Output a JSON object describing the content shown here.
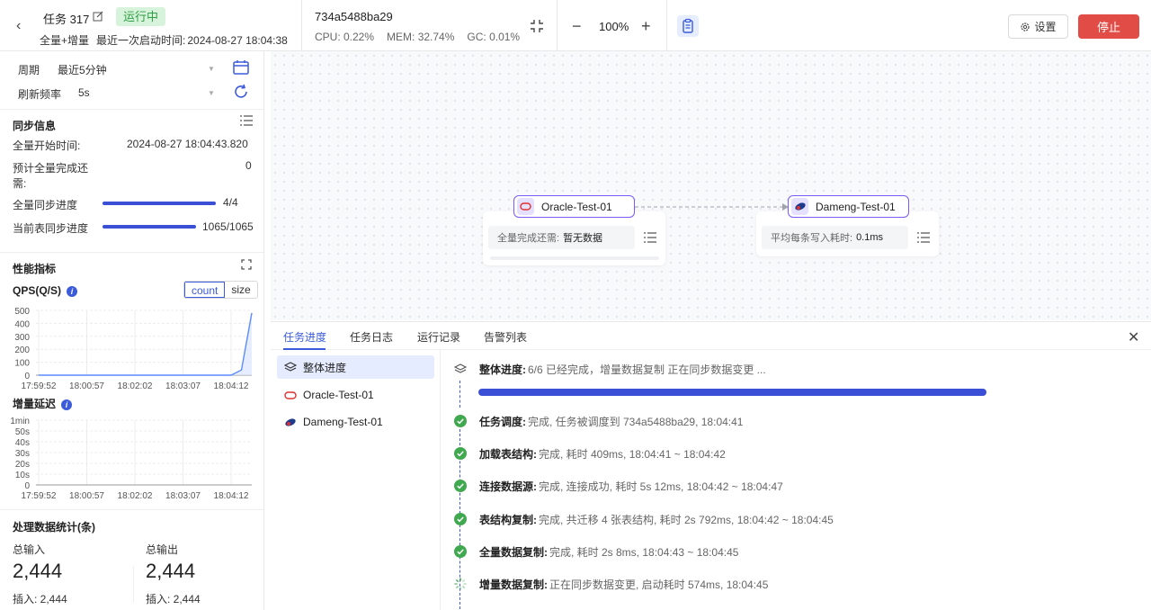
{
  "header": {
    "back_glyph": "‹",
    "task_name": "任务 317",
    "status": "运行中",
    "sync_type": "全量+增量",
    "last_start_label": "最近一次启动时间:",
    "last_start_time": "2024-08-27 18:04:38",
    "agent_id": "734a5488ba29",
    "cpu": "CPU:  0.22%",
    "mem": "MEM:  32.74%",
    "gc": "GC:  0.01%",
    "zoom": "100%",
    "zoom_out": "−",
    "zoom_in": "+",
    "settings_label": "设置",
    "stop_label": "停止",
    "colors": {
      "status_bg": "#d8f3dc",
      "status_fg": "#2f9e44",
      "stop": "#e24c46",
      "accent": "#3b5bdb"
    }
  },
  "filters": {
    "period_label": "周期",
    "period_value": "最近5分钟",
    "refresh_label": "刷新频率",
    "refresh_value": "5s"
  },
  "sync_info": {
    "title": "同步信息",
    "full_start_label": "全量开始时间:",
    "full_start_value": "2024-08-27 18:04:43.820",
    "eta_label_1": "预计全量完成还",
    "eta_label_2": "需:",
    "eta_value": "0",
    "full_progress_label": "全量同步进度",
    "full_progress_text": "4/4",
    "full_progress": 1.0,
    "table_progress_label": "当前表同步进度",
    "table_progress_text": "1065/1065",
    "table_progress": 1.0
  },
  "perf": {
    "title": "性能指标",
    "qps_label": "QPS(Q/S)",
    "count_label": "count",
    "size_label": "size",
    "delay_label": "增量延迟",
    "qps_ticks": [
      "500",
      "400",
      "300",
      "200",
      "100",
      "0"
    ],
    "delay_ticks": [
      "1min",
      "50s",
      "40s",
      "30s",
      "20s",
      "10s",
      "0"
    ],
    "time_ticks": [
      "17:59:52",
      "18:00:57",
      "18:02:02",
      "18:03:07",
      "18:04:12"
    ]
  },
  "chart_data": [
    {
      "type": "area",
      "title": "QPS(Q/S)",
      "xlabel": "",
      "ylabel": "",
      "ylim": [
        0,
        500
      ],
      "x": [
        "17:59:52",
        "18:00:57",
        "18:02:02",
        "18:03:07",
        "18:04:12",
        "18:04:20",
        "18:04:28"
      ],
      "values": [
        0,
        0,
        0,
        0,
        0,
        40,
        480
      ],
      "grid": true
    },
    {
      "type": "line",
      "title": "增量延迟",
      "xlabel": "",
      "ylabel": "",
      "ylim": [
        0,
        60
      ],
      "x": [
        "17:59:52",
        "18:00:57",
        "18:02:02",
        "18:03:07",
        "18:04:12"
      ],
      "values": [],
      "grid": true
    }
  ],
  "stats": {
    "title": "处理数据统计(条)",
    "total_in_label": "总输入",
    "total_in": "2,444",
    "total_out_label": "总输出",
    "total_out": "2,444",
    "insert_in": "插入:  2,444",
    "insert_out": "插入:  2,444"
  },
  "nodes": {
    "source_name": "Oracle-Test-01",
    "source_stat_label": "全量完成还需:",
    "source_stat_value": "暂无数据",
    "target_name": "Dameng-Test-01",
    "target_stat_label": "平均每条写入耗时:",
    "target_stat_value": "0.1ms"
  },
  "bottom": {
    "tabs": [
      "任务进度",
      "任务日志",
      "运行记录",
      "告警列表"
    ],
    "close_glyph": "✕",
    "side_items": [
      "整体进度",
      "Oracle-Test-01",
      "Dameng-Test-01"
    ],
    "overall_title": "整体进度:",
    "overall_desc": "6/6 已经完成，增量数据复制 正在同步数据变更 ...",
    "overall_progress": 1.0,
    "steps": [
      {
        "title": "任务调度:",
        "desc": "完成, 任务被调度到 734a5488ba29, 18:04:41"
      },
      {
        "title": "加载表结构:",
        "desc": "完成, 耗时 409ms, 18:04:41 ~ 18:04:42"
      },
      {
        "title": "连接数据源:",
        "desc": "完成, 连接成功, 耗时 5s 12ms, 18:04:42 ~ 18:04:47"
      },
      {
        "title": "表结构复制:",
        "desc": "完成, 共迁移 4 张表结构, 耗时 2s 792ms, 18:04:42 ~ 18:04:45"
      },
      {
        "title": "全量数据复制:",
        "desc": "完成, 耗时 2s 8ms, 18:04:43 ~ 18:04:45"
      },
      {
        "title": "增量数据复制:",
        "desc": "正在同步数据变更, 启动耗时 574ms, 18:04:45"
      }
    ]
  }
}
